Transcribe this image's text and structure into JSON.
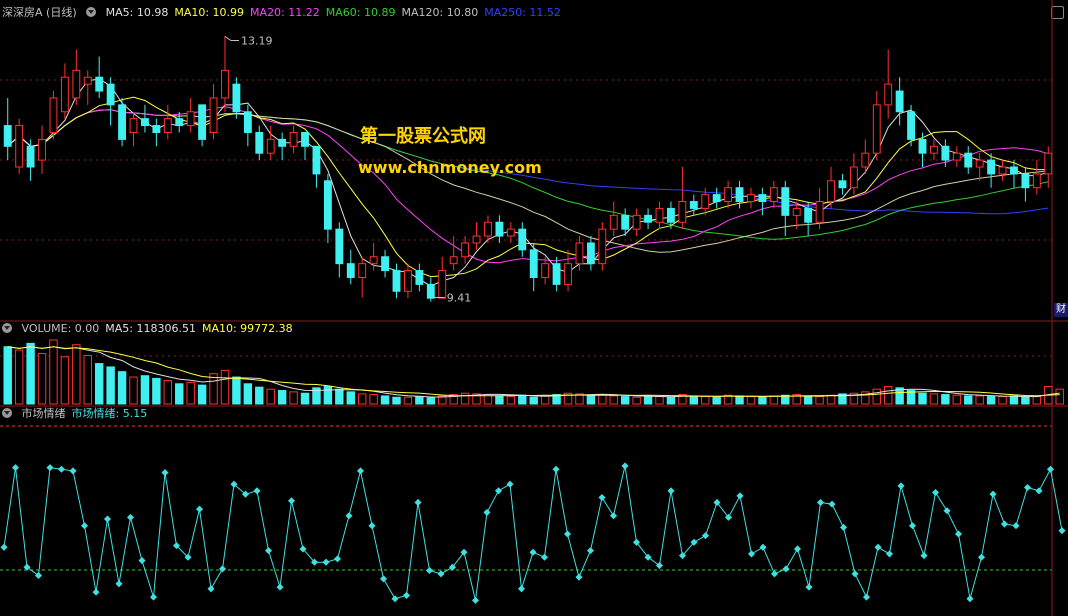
{
  "header_main": {
    "stock_name": "深深房A (日线)",
    "items": [
      {
        "label": "MA5: 10.98",
        "color": "#e0e0e0"
      },
      {
        "label": "MA10: 10.99",
        "color": "#ffff40"
      },
      {
        "label": "MA20: 11.22",
        "color": "#ff40ff"
      },
      {
        "label": "MA60: 10.89",
        "color": "#30d030"
      },
      {
        "label": "MA120: 10.80",
        "color": "#c0c0c0"
      },
      {
        "label": "MA250: 11.52",
        "color": "#3040ff"
      }
    ]
  },
  "header_volume": {
    "items": [
      {
        "label": "VOLUME: 0.00",
        "color": "#c0c0c0"
      },
      {
        "label": "MA5: 118306.51",
        "color": "#e0e0e0"
      },
      {
        "label": "MA10: 99772.38",
        "color": "#ffff40"
      }
    ]
  },
  "header_sentiment": {
    "items": [
      {
        "label": "市场情绪",
        "color": "#c0c0c0"
      },
      {
        "label": "市场情绪: 5.15",
        "color": "#40e0e0"
      }
    ]
  },
  "watermark": {
    "line1": "第一股票公式网",
    "line2": "www.chnmoney.com"
  },
  "side_tab": "财",
  "colors": {
    "up": "#ff3030",
    "down": "#40f0f0",
    "ma5": "#e0e0e0",
    "ma10": "#ffff40",
    "ma20": "#ff40ff",
    "ma60": "#30d030",
    "ma250": "#3040ff",
    "grid": "#8b1a1a",
    "sentiment": "#40e0e0",
    "level": "#30d030"
  },
  "chart_data": [
    {
      "type": "candlestick",
      "title": "深深房A (日线)",
      "annotations": [
        {
          "text": "13.19",
          "value": 13.19
        },
        {
          "text": "9.41",
          "value": 9.41
        }
      ],
      "price_range": [
        9.2,
        13.4
      ],
      "candles": [
        [
          11.9,
          11.6,
          12.3,
          11.4
        ],
        [
          11.3,
          11.9,
          12.0,
          11.2
        ],
        [
          11.6,
          11.3,
          11.7,
          11.1
        ],
        [
          11.4,
          11.7,
          11.9,
          11.2
        ],
        [
          11.8,
          12.3,
          12.4,
          11.7
        ],
        [
          12.1,
          12.6,
          12.8,
          12.0
        ],
        [
          12.3,
          12.7,
          13.0,
          12.2
        ],
        [
          12.5,
          12.6,
          12.7,
          12.2
        ],
        [
          12.6,
          12.4,
          12.9,
          12.3
        ],
        [
          12.5,
          12.2,
          12.6,
          11.9
        ],
        [
          12.2,
          11.7,
          12.3,
          11.6
        ],
        [
          11.8,
          12.0,
          12.1,
          11.6
        ],
        [
          12.0,
          11.9,
          12.2,
          11.8
        ],
        [
          11.9,
          11.8,
          12.0,
          11.6
        ],
        [
          11.8,
          12.0,
          12.2,
          11.7
        ],
        [
          12.0,
          11.9,
          12.1,
          11.8
        ],
        [
          11.9,
          12.1,
          12.3,
          11.8
        ],
        [
          12.2,
          11.7,
          12.2,
          11.6
        ],
        [
          11.8,
          12.3,
          12.5,
          11.7
        ],
        [
          12.3,
          12.7,
          13.2,
          12.1
        ],
        [
          12.5,
          12.1,
          12.6,
          12.0
        ],
        [
          12.1,
          11.8,
          12.2,
          11.6
        ],
        [
          11.8,
          11.5,
          11.9,
          11.4
        ],
        [
          11.5,
          11.7,
          11.9,
          11.4
        ],
        [
          11.7,
          11.6,
          11.8,
          11.4
        ],
        [
          11.6,
          11.8,
          11.9,
          11.5
        ],
        [
          11.8,
          11.6,
          11.8,
          11.4
        ],
        [
          11.6,
          11.2,
          11.6,
          11.0
        ],
        [
          11.1,
          10.4,
          11.2,
          10.2
        ],
        [
          10.4,
          9.9,
          10.5,
          9.7
        ],
        [
          9.9,
          9.7,
          10.1,
          9.6
        ],
        [
          9.7,
          9.9,
          10.0,
          9.41
        ],
        [
          9.9,
          10.0,
          10.2,
          9.8
        ],
        [
          10.0,
          9.8,
          10.1,
          9.7
        ],
        [
          9.8,
          9.5,
          9.9,
          9.4
        ],
        [
          9.5,
          9.8,
          9.9,
          9.4
        ],
        [
          9.8,
          9.6,
          9.9,
          9.5
        ],
        [
          9.6,
          9.4,
          9.7,
          9.35
        ],
        [
          9.4,
          9.8,
          10.0,
          9.4
        ],
        [
          9.9,
          10.0,
          10.3,
          9.8
        ],
        [
          10.0,
          10.2,
          10.3,
          9.9
        ],
        [
          10.2,
          10.3,
          10.5,
          10.1
        ],
        [
          10.3,
          10.5,
          10.6,
          10.2
        ],
        [
          10.5,
          10.3,
          10.6,
          10.2
        ],
        [
          10.3,
          10.4,
          10.5,
          10.2
        ],
        [
          10.4,
          10.1,
          10.5,
          10.0
        ],
        [
          10.1,
          9.7,
          10.2,
          9.5
        ],
        [
          9.7,
          9.9,
          10.0,
          9.6
        ],
        [
          9.9,
          9.6,
          10.0,
          9.5
        ],
        [
          9.6,
          9.9,
          10.1,
          9.5
        ],
        [
          9.9,
          10.2,
          10.3,
          9.8
        ],
        [
          10.2,
          9.9,
          10.3,
          9.8
        ],
        [
          9.9,
          10.4,
          10.5,
          9.8
        ],
        [
          10.4,
          10.6,
          10.8,
          10.3
        ],
        [
          10.6,
          10.4,
          10.7,
          10.3
        ],
        [
          10.4,
          10.6,
          10.7,
          10.3
        ],
        [
          10.6,
          10.5,
          10.7,
          10.4
        ],
        [
          10.5,
          10.7,
          10.8,
          10.4
        ],
        [
          10.7,
          10.5,
          10.8,
          10.4
        ],
        [
          10.5,
          10.8,
          11.3,
          10.4
        ],
        [
          10.8,
          10.7,
          10.9,
          10.6
        ],
        [
          10.7,
          10.9,
          11.0,
          10.6
        ],
        [
          10.9,
          10.8,
          11.0,
          10.7
        ],
        [
          10.8,
          11.0,
          11.1,
          10.7
        ],
        [
          11.0,
          10.8,
          11.1,
          10.7
        ],
        [
          10.8,
          10.9,
          11.0,
          10.7
        ],
        [
          10.9,
          10.8,
          11.0,
          10.6
        ],
        [
          10.8,
          11.0,
          11.1,
          10.7
        ],
        [
          11.0,
          10.6,
          11.1,
          10.3
        ],
        [
          10.6,
          10.7,
          10.8,
          10.4
        ],
        [
          10.7,
          10.5,
          10.8,
          10.3
        ],
        [
          10.5,
          10.8,
          11.0,
          10.4
        ],
        [
          10.8,
          11.1,
          11.3,
          10.7
        ],
        [
          11.1,
          11.0,
          11.2,
          10.9
        ],
        [
          11.0,
          11.3,
          11.5,
          10.9
        ],
        [
          11.3,
          11.5,
          11.7,
          11.2
        ],
        [
          11.5,
          12.2,
          12.4,
          11.4
        ],
        [
          12.2,
          12.5,
          13.0,
          12.0
        ],
        [
          12.4,
          12.1,
          12.6,
          11.9
        ],
        [
          12.1,
          11.7,
          12.2,
          11.6
        ],
        [
          11.7,
          11.5,
          11.8,
          11.3
        ],
        [
          11.5,
          11.6,
          11.7,
          11.4
        ],
        [
          11.6,
          11.4,
          11.7,
          11.3
        ],
        [
          11.4,
          11.5,
          11.6,
          11.3
        ],
        [
          11.5,
          11.3,
          11.6,
          11.2
        ],
        [
          11.3,
          11.4,
          11.5,
          11.1
        ],
        [
          11.4,
          11.2,
          11.5,
          11.0
        ],
        [
          11.2,
          11.3,
          11.4,
          11.1
        ],
        [
          11.3,
          11.2,
          11.4,
          11.0
        ],
        [
          11.2,
          11.0,
          11.3,
          10.8
        ],
        [
          11.0,
          11.2,
          11.4,
          10.9
        ],
        [
          11.2,
          11.5,
          11.6,
          11.0
        ]
      ]
    },
    {
      "type": "bar",
      "title": "VOLUME",
      "series": [
        {
          "name": "VOLUME",
          "values": [
            85,
            80,
            90,
            75,
            95,
            70,
            88,
            72,
            60,
            55,
            48,
            40,
            42,
            38,
            35,
            30,
            32,
            28,
            45,
            50,
            40,
            30,
            25,
            22,
            20,
            18,
            16,
            24,
            26,
            22,
            18,
            15,
            14,
            12,
            10,
            10,
            11,
            9,
            12,
            14,
            16,
            15,
            14,
            12,
            11,
            13,
            10,
            12,
            14,
            16,
            15,
            13,
            14,
            12,
            11,
            10,
            12,
            11,
            10,
            14,
            12,
            11,
            10,
            13,
            12,
            11,
            10,
            12,
            13,
            14,
            12,
            11,
            13,
            15,
            16,
            18,
            22,
            26,
            24,
            20,
            16,
            15,
            14,
            13,
            12,
            12,
            11,
            11,
            12,
            10,
            11,
            26,
            22
          ]
        }
      ]
    },
    {
      "type": "line",
      "title": "市场情绪",
      "series": [
        {
          "name": "市场情绪",
          "values": [
            4.2,
            9.0,
            3.0,
            2.5,
            9.0,
            8.9,
            8.8,
            5.5,
            1.5,
            5.9,
            2.0,
            6.0,
            3.4,
            1.2,
            8.7,
            4.3,
            3.6,
            6.5,
            1.7,
            2.9,
            8.0,
            7.4,
            7.6,
            4.0,
            1.8,
            7.0,
            4.1,
            3.3,
            3.3,
            3.5,
            6.1,
            8.8,
            5.5,
            2.3,
            1.1,
            1.3,
            6.9,
            2.8,
            2.6,
            3.0,
            3.9,
            1.0,
            6.3,
            7.6,
            8.0,
            1.7,
            3.9,
            3.6,
            8.9,
            5.0,
            2.4,
            4.0,
            7.2,
            6.1,
            9.1,
            4.5,
            3.6,
            3.1,
            7.6,
            3.7,
            4.5,
            4.9,
            6.9,
            6.0,
            7.3,
            3.8,
            4.2,
            2.6,
            2.9,
            4.1,
            1.8,
            6.9,
            6.8,
            5.4,
            2.6,
            1.2,
            4.2,
            3.8,
            7.9,
            5.5,
            3.7,
            7.5,
            6.4,
            5.0,
            1.1,
            3.6,
            7.4,
            5.6,
            5.5,
            7.8,
            7.6,
            8.9,
            5.2
          ]
        }
      ]
    }
  ]
}
